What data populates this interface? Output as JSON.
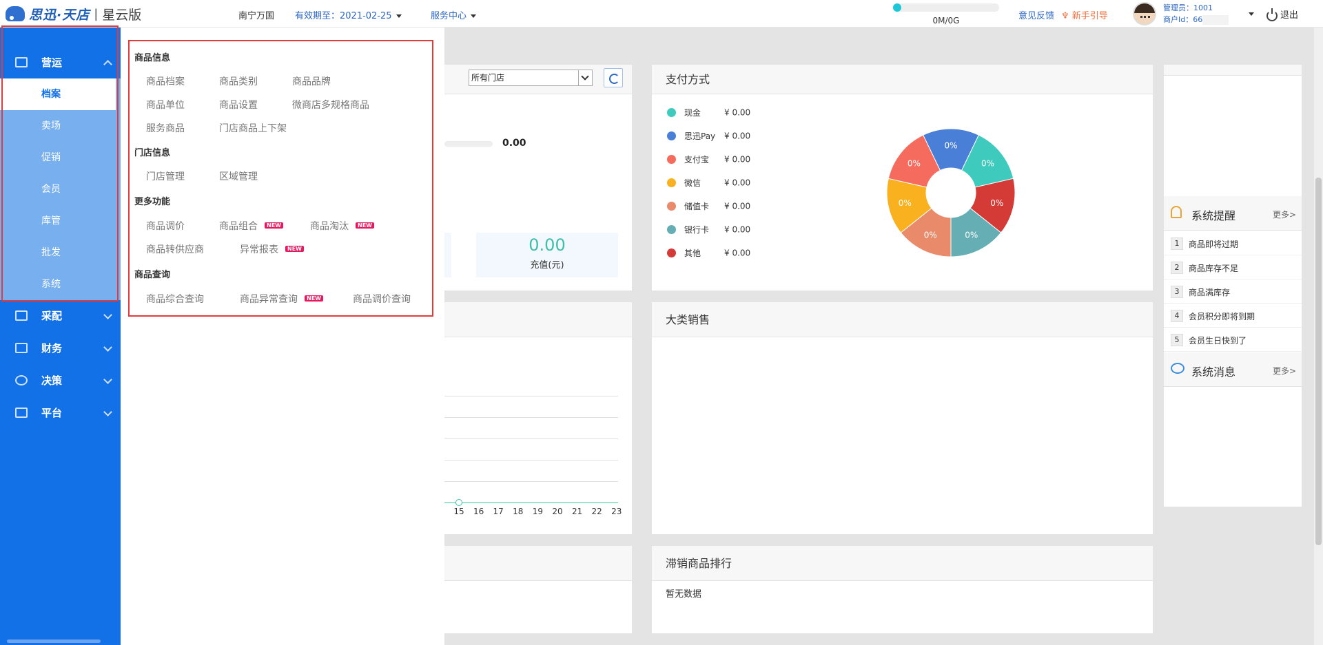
{
  "header": {
    "logo": {
      "main": "思迅·天店",
      "sub": "星云版"
    },
    "store": "南宁万国",
    "expiry_label": "有效期至：",
    "expiry_date": "2021-02-25",
    "service_center": "服务中心",
    "storage": {
      "used_fraction": 0.02,
      "text": "0M/0G"
    },
    "feedback": "意见反馈",
    "guide": "新手引导",
    "admin_line": "管理员：1001",
    "merchant_line": "商户Id：66",
    "logout": "退出"
  },
  "sidebar": {
    "groups": [
      {
        "label": "营运",
        "expanded": true
      },
      {
        "label": "采配"
      },
      {
        "label": "财务"
      },
      {
        "label": "决策"
      },
      {
        "label": "平台"
      }
    ],
    "operations_items": [
      "档案",
      "卖场",
      "促销",
      "会员",
      "库管",
      "批发",
      "系统"
    ],
    "active_item": "档案"
  },
  "mega_menu": {
    "sections": [
      {
        "title": "商品信息",
        "links": [
          "商品档案",
          "商品类别",
          "商品品牌",
          "商品单位",
          "商品设置",
          "微商店多规格商品",
          "服务商品",
          "门店商品上下架"
        ]
      },
      {
        "title": "门店信息",
        "links": [
          "门店管理",
          "区域管理"
        ]
      },
      {
        "title": "更多功能",
        "links": [
          "商品调价",
          "商品组合",
          "商品淘汰",
          "商品转供应商",
          "异常报表"
        ]
      },
      {
        "title": "商品查询",
        "links": [
          "商品综合查询",
          "商品异常查询",
          "商品调价查询"
        ]
      }
    ],
    "new_badge": "NEW"
  },
  "sales_panel": {
    "store_select": "所有门店",
    "amount": "0.00",
    "recharge_value": "0.00",
    "recharge_label": "充值(元)",
    "x_ticks": [
      "15",
      "16",
      "17",
      "18",
      "19",
      "20",
      "21",
      "22",
      "23"
    ]
  },
  "payment": {
    "title": "支付方式",
    "items": [
      {
        "name": "现金",
        "amount": "¥ 0.00",
        "color": "#3ecbbd"
      },
      {
        "name": "思迅Pay",
        "amount": "¥ 0.00",
        "color": "#4a7fd8"
      },
      {
        "name": "支付宝",
        "amount": "¥ 0.00",
        "color": "#f56b5e"
      },
      {
        "name": "微信",
        "amount": "¥ 0.00",
        "color": "#f9b11f"
      },
      {
        "name": "储值卡",
        "amount": "¥ 0.00",
        "color": "#e98a6b"
      },
      {
        "name": "银行卡",
        "amount": "¥ 0.00",
        "color": "#64aeb4"
      },
      {
        "name": "其他",
        "amount": "¥ 0.00",
        "color": "#d43a36"
      }
    ]
  },
  "chart_data": {
    "type": "pie",
    "title": "支付方式",
    "slices": [
      {
        "name": "思迅Pay",
        "value": 0,
        "label": "0%",
        "color": "#4a7fd8"
      },
      {
        "name": "现金",
        "value": 0,
        "label": "0%",
        "color": "#3ecbbd"
      },
      {
        "name": "其他",
        "value": 0,
        "label": "0%",
        "color": "#d43a36"
      },
      {
        "name": "银行卡",
        "value": 0,
        "label": "0%",
        "color": "#64aeb4"
      },
      {
        "name": "储值卡",
        "value": 0,
        "label": "0%",
        "color": "#e98a6b"
      },
      {
        "name": "微信",
        "value": 0,
        "label": "0%",
        "color": "#f9b11f"
      },
      {
        "name": "支付宝",
        "value": 0,
        "label": "0%",
        "color": "#f56b5e"
      }
    ]
  },
  "category_sales": {
    "title": "大类销售"
  },
  "slow_moving": {
    "title": "滞销商品排行",
    "empty_text": "暂无数据"
  },
  "system_reminder": {
    "title": "系统提醒",
    "more": "更多>",
    "items": [
      {
        "num": "1",
        "text": "商品即将过期"
      },
      {
        "num": "2",
        "text": "商品库存不足"
      },
      {
        "num": "3",
        "text": "商品满库存"
      },
      {
        "num": "4",
        "text": "会员积分即将到期"
      },
      {
        "num": "5",
        "text": "会员生日快到了"
      }
    ]
  },
  "system_message": {
    "title": "系统消息",
    "more": "更多>"
  }
}
